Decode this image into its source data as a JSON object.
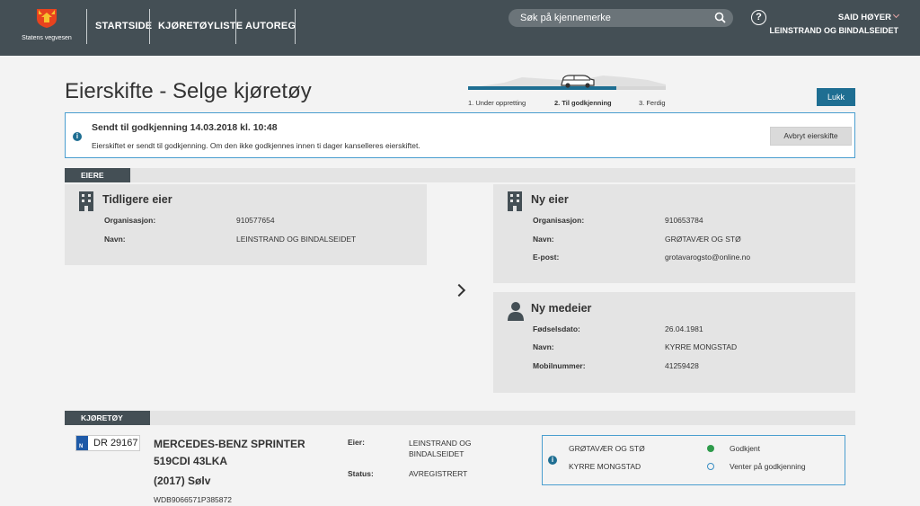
{
  "header": {
    "logo_text": "Statens vegvesen",
    "nav": [
      "STARTSIDE",
      "KJØRETØYLISTE",
      "AUTOREG"
    ],
    "search_placeholder": "Søk på kjennemerke",
    "help_label": "?",
    "user_name": "SAID HØYER",
    "user_org": "LEINSTRAND OG BINDALSEIDET"
  },
  "page": {
    "title": "Eierskifte - Selge kjøretøy",
    "steps": [
      "1. Under oppretting",
      "2. Til godkjenning",
      "3. Ferdig"
    ],
    "active_step": 2,
    "close_label": "Lukk"
  },
  "info": {
    "title": "Sendt til godkjenning 14.03.2018 kl. 10:48",
    "text": "Eierskiftet er sendt til godkjenning. Om den ikke godkjennes innen ti dager kanselleres eierskiftet.",
    "cancel_label": "Avbryt eierskifte"
  },
  "owners": {
    "section_label": "EIERE",
    "previous": {
      "title": "Tidligere eier",
      "org_label": "Organisasjon:",
      "org_value": "910577654",
      "name_label": "Navn:",
      "name_value": "LEINSTRAND OG BINDALSEIDET"
    },
    "new_owner": {
      "title": "Ny eier",
      "org_label": "Organisasjon:",
      "org_value": "910653784",
      "name_label": "Navn:",
      "name_value": "GRØTAVÆR OG STØ",
      "email_label": "E-post:",
      "email_value": "grotavarogsto@online.no"
    },
    "co_owner": {
      "title": "Ny medeier",
      "dob_label": "Fødselsdato:",
      "dob_value": "26.04.1981",
      "name_label": "Navn:",
      "name_value": "KYRRE MONGSTAD",
      "mobile_label": "Mobilnummer:",
      "mobile_value": "41259428"
    }
  },
  "vehicle": {
    "section_label": "KJØRETØY",
    "plate_country": "N",
    "plate": "DR 29167",
    "name": "MERCEDES-BENZ SPRINTER 519CDI 43LKA",
    "year_color": "(2017) Sølv",
    "vin": "WDB9066571P385872",
    "owner_label": "Eier:",
    "owner_value": "LEINSTRAND OG BINDALSEIDET",
    "status_label": "Status:",
    "status_value": "AVREGISTRERT",
    "approvals": [
      {
        "name": "GRØTAVÆR OG STØ",
        "status": "Godkjent",
        "state": "ok"
      },
      {
        "name": "KYRRE MONGSTAD",
        "status": "Venter på godkjenning",
        "state": "waiting"
      }
    ]
  },
  "colors": {
    "header_bg": "#444f55",
    "accent": "#1e6e92",
    "info_border": "#4a9ecf",
    "ok": "#2e9b4b"
  }
}
